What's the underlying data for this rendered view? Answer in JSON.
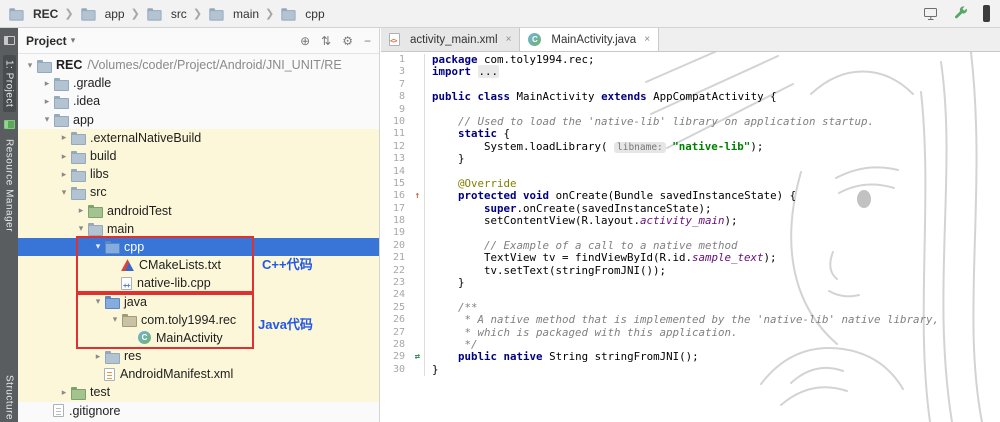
{
  "colors": {
    "selection_blue": "#3875d7",
    "tint_yellow": "#fbf7d8",
    "annotation_box_red": "#e03131",
    "annotation_text_blue": "#2457e6",
    "keyword_navy": "#000080",
    "string_green": "#008000",
    "comment_gray": "#808080",
    "field_purple": "#660e7a",
    "wrench_green": "#59a869"
  },
  "topbar": {
    "breadcrumbs": [
      {
        "label": "REC",
        "bold": true
      },
      {
        "label": "app"
      },
      {
        "label": "src"
      },
      {
        "label": "main"
      },
      {
        "label": "cpp"
      }
    ],
    "icons": [
      "device-monitor-icon",
      "build-wrench-icon",
      "more-icon"
    ]
  },
  "tool_window_bar": {
    "top_items": [
      "1: Project",
      "Resource Manager"
    ],
    "bottom_items": [
      "Structure"
    ]
  },
  "project_panel": {
    "title": "Project",
    "header_icons": [
      {
        "name": "locate-icon",
        "glyph": "⊕"
      },
      {
        "name": "collapse-all-icon",
        "glyph": "⇅"
      },
      {
        "name": "settings-icon",
        "glyph": "⚙"
      },
      {
        "name": "hide-icon",
        "glyph": "−"
      }
    ],
    "tree": [
      {
        "label": "REC",
        "suffix": " /Volumes/coder/Project/Android/JNI_UNIT/RE",
        "level": 0,
        "chevron": "down",
        "icon": "folder",
        "bold": true
      },
      {
        "label": ".gradle",
        "level": 1,
        "chevron": "right",
        "icon": "folder"
      },
      {
        "label": ".idea",
        "level": 1,
        "chevron": "right",
        "icon": "folder"
      },
      {
        "label": "app",
        "level": 1,
        "chevron": "down",
        "icon": "module"
      },
      {
        "label": ".externalNativeBuild",
        "level": 2,
        "chevron": "right",
        "icon": "folder",
        "tint": true
      },
      {
        "label": "build",
        "level": 2,
        "chevron": "right",
        "icon": "folder",
        "tint": true
      },
      {
        "label": "libs",
        "level": 2,
        "chevron": "right",
        "icon": "folder",
        "tint": true
      },
      {
        "label": "src",
        "level": 2,
        "chevron": "down",
        "icon": "folder",
        "tint": true
      },
      {
        "label": "androidTest",
        "level": 3,
        "chevron": "right",
        "icon": "folder-green",
        "tint": true
      },
      {
        "label": "main",
        "level": 3,
        "chevron": "down",
        "icon": "folder",
        "tint": true
      },
      {
        "label": "cpp",
        "level": 4,
        "chevron": "down",
        "icon": "folder-blue",
        "selected": true
      },
      {
        "label": "CMakeLists.txt",
        "level": 5,
        "icon": "cmake",
        "tint": true
      },
      {
        "label": "native-lib.cpp",
        "level": 5,
        "icon": "cpp-file",
        "tint": true
      },
      {
        "label": "java",
        "level": 4,
        "chevron": "down",
        "icon": "folder-blue",
        "tint": true
      },
      {
        "label": "com.toly1994.rec",
        "level": 5,
        "chevron": "down",
        "icon": "package",
        "tint": true
      },
      {
        "label": "MainActivity",
        "level": 6,
        "icon": "class",
        "tint": true
      },
      {
        "label": "res",
        "level": 4,
        "chevron": "right",
        "icon": "folder",
        "tint": true
      },
      {
        "label": "AndroidManifest.xml",
        "level": 4,
        "icon": "manifest",
        "tint": true
      },
      {
        "label": "test",
        "level": 2,
        "chevron": "right",
        "icon": "folder-green",
        "tint": true
      },
      {
        "label": ".gitignore",
        "level": 1,
        "icon": "file"
      }
    ],
    "overlays": [
      {
        "text": "C++代码"
      },
      {
        "text": "Java代码"
      }
    ]
  },
  "editor": {
    "tabs": [
      {
        "label": "activity_main.xml",
        "icon": "android-xml",
        "active": false
      },
      {
        "label": "MainActivity.java",
        "icon": "java-class",
        "active": true
      }
    ],
    "close_glyph": "×",
    "code_lines": [
      {
        "n": "1",
        "seg": [
          {
            "t": "package",
            "c": "kw"
          },
          {
            "t": " com.toly1994.rec;"
          }
        ]
      },
      {
        "n": "3",
        "seg": [
          {
            "t": "import",
            "c": "kw"
          },
          {
            "t": " "
          },
          {
            "t": "...",
            "c": "fold"
          }
        ]
      },
      {
        "n": "7",
        "seg": []
      },
      {
        "n": "8",
        "seg": [
          {
            "t": "public",
            "c": "kw"
          },
          {
            "t": " "
          },
          {
            "t": "class",
            "c": "kw"
          },
          {
            "t": " MainActivity "
          },
          {
            "t": "extends",
            "c": "kw"
          },
          {
            "t": " AppCompatActivity {"
          }
        ]
      },
      {
        "n": "9",
        "seg": []
      },
      {
        "n": "10",
        "seg": [
          {
            "t": "    // Used to load the 'native-lib' library on application startup.",
            "c": "cm"
          }
        ]
      },
      {
        "n": "11",
        "seg": [
          {
            "t": "    "
          },
          {
            "t": "static",
            "c": "kw"
          },
          {
            "t": " {"
          }
        ]
      },
      {
        "n": "12",
        "seg": [
          {
            "t": "        System.loadLibrary( "
          },
          {
            "t": "libname:",
            "c": "hint"
          },
          {
            "t": " "
          },
          {
            "t": "\"native-lib\"",
            "c": "str"
          },
          {
            "t": ");"
          }
        ]
      },
      {
        "n": "13",
        "seg": [
          {
            "t": "    }"
          }
        ]
      },
      {
        "n": "14",
        "seg": []
      },
      {
        "n": "15",
        "seg": [
          {
            "t": "    "
          },
          {
            "t": "@Override",
            "c": "ann"
          }
        ]
      },
      {
        "n": "16",
        "marker": "override",
        "seg": [
          {
            "t": "    "
          },
          {
            "t": "protected",
            "c": "kw"
          },
          {
            "t": " "
          },
          {
            "t": "void",
            "c": "kw"
          },
          {
            "t": " onCreate(Bundle savedInstanceState) {"
          }
        ]
      },
      {
        "n": "17",
        "seg": [
          {
            "t": "        "
          },
          {
            "t": "super",
            "c": "kw"
          },
          {
            "t": ".onCreate(savedInstanceState);"
          }
        ]
      },
      {
        "n": "18",
        "seg": [
          {
            "t": "        setContentView(R.layout."
          },
          {
            "t": "activity_main",
            "c": "fld"
          },
          {
            "t": ");"
          }
        ]
      },
      {
        "n": "19",
        "seg": []
      },
      {
        "n": "20",
        "seg": [
          {
            "t": "        // Example of a call to a native method",
            "c": "cm"
          }
        ]
      },
      {
        "n": "21",
        "seg": [
          {
            "t": "        TextView tv = findViewById(R.id."
          },
          {
            "t": "sample_text",
            "c": "fld"
          },
          {
            "t": ");"
          }
        ]
      },
      {
        "n": "22",
        "seg": [
          {
            "t": "        tv.setText(stringFromJNI());"
          }
        ]
      },
      {
        "n": "23",
        "seg": [
          {
            "t": "    }"
          }
        ]
      },
      {
        "n": "24",
        "seg": []
      },
      {
        "n": "25",
        "seg": [
          {
            "t": "    /**",
            "c": "cm"
          }
        ]
      },
      {
        "n": "26",
        "seg": [
          {
            "t": "     * A native method that is implemented by the 'native-lib' native library,",
            "c": "cm"
          }
        ]
      },
      {
        "n": "27",
        "seg": [
          {
            "t": "     * which is packaged with this application.",
            "c": "cm"
          }
        ]
      },
      {
        "n": "28",
        "seg": [
          {
            "t": "     */",
            "c": "cm"
          }
        ]
      },
      {
        "n": "29",
        "marker": "native",
        "seg": [
          {
            "t": "    "
          },
          {
            "t": "public",
            "c": "kw"
          },
          {
            "t": " "
          },
          {
            "t": "native",
            "c": "kw"
          },
          {
            "t": " String stringFromJNI();"
          }
        ]
      },
      {
        "n": "30",
        "seg": [
          {
            "t": "}"
          }
        ]
      }
    ]
  }
}
